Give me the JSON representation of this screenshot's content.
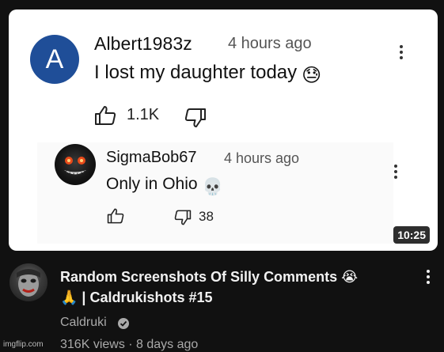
{
  "thumbnail": {
    "comment1": {
      "avatar_letter": "A",
      "author": "Albert1983z",
      "time": "4 hours ago",
      "text": "I lost my daughter today",
      "emoji": "😓",
      "likes": "1.1K"
    },
    "reply": {
      "author": "SigmaBob67",
      "time": "4 hours ago",
      "text": "Only in Ohio",
      "emoji": "💀",
      "dislikes": "38"
    },
    "duration": "10:25"
  },
  "video": {
    "title_line1": "Random Screenshots Of Silly Comments 😭",
    "title_line2": "🙏 | Caldrukishots #15",
    "channel": "Caldruki",
    "meta": "316K views · 8 days ago"
  },
  "watermark": "imgflip.com",
  "icons": [
    "thumbs-up-icon",
    "thumbs-down-icon",
    "kebab-menu-icon",
    "verified-check-icon"
  ],
  "colors": {
    "avatar_blue": "#1f4e98",
    "background": "#111111",
    "text_primary": "#f1f1f1",
    "text_secondary": "#aaaaaa"
  }
}
